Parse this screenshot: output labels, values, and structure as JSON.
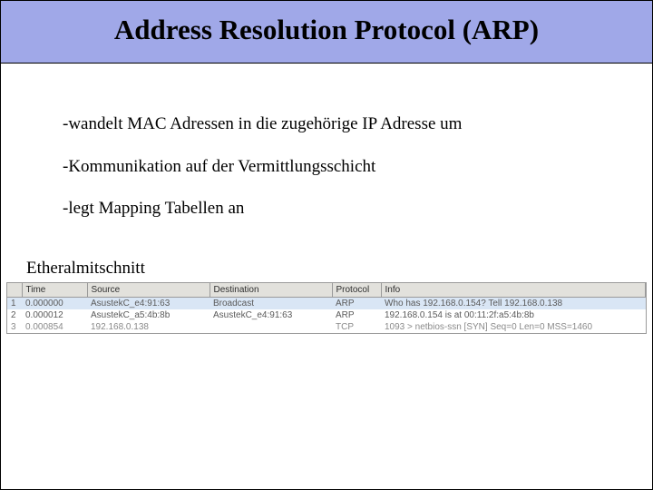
{
  "title": "Address Resolution Protocol (ARP)",
  "bullets": {
    "b1": "-wandelt MAC Adressen in die zugehörige IP Adresse um",
    "b2": "-Kommunikation auf der Vermittlungsschicht",
    "b3": "-legt Mapping Tabellen an"
  },
  "caption": "Etheralmitschnitt",
  "table": {
    "headers": {
      "time": "Time",
      "source": "Source",
      "destination": "Destination",
      "protocol": "Protocol",
      "info": "Info"
    },
    "rows": [
      {
        "no": "1",
        "time": "0.000000",
        "src": "AsustekC_e4:91:63",
        "dst": "Broadcast",
        "proto": "ARP",
        "info": "Who has 192.168.0.154?  Tell 192.168.0.138"
      },
      {
        "no": "2",
        "time": "0.000012",
        "src": "AsustekC_a5:4b:8b",
        "dst": "AsustekC_e4:91:63",
        "proto": "ARP",
        "info": "192.168.0.154 is at 00:11:2f:a5:4b:8b"
      },
      {
        "no": "3",
        "time": "0.000854",
        "src": "192.168.0.138",
        "dst": "",
        "proto": "TCP",
        "info": "1093 > netbios-ssn [SYN] Seq=0 Len=0 MSS=1460"
      }
    ]
  }
}
